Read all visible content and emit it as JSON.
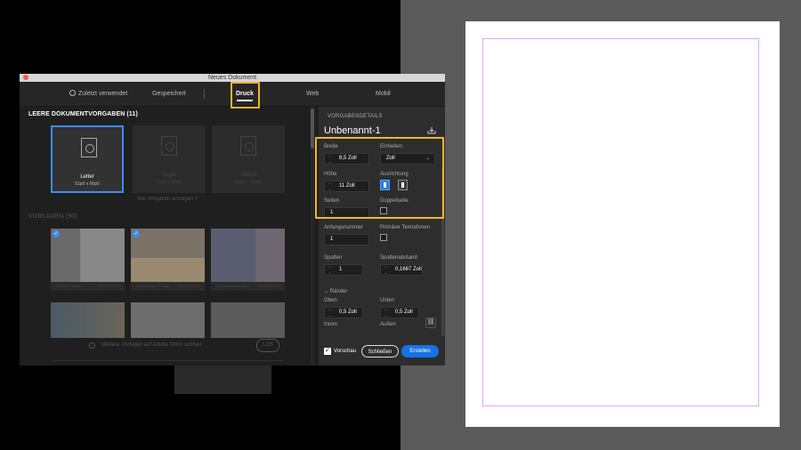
{
  "dialog": {
    "title": "Neues Dokument",
    "tabs": [
      {
        "label": "Zuletzt verwendet"
      },
      {
        "label": "Gespeichert"
      },
      {
        "label": "Druck",
        "active": true
      },
      {
        "label": "Web"
      },
      {
        "label": "Mobil"
      }
    ]
  },
  "presets": {
    "heading": "LEERE DOKUMENTVORGABEN (11)",
    "items": [
      {
        "name": "Letter",
        "size": "51p0 x 66p0"
      },
      {
        "name": "Legal",
        "size": "51p0 x 84p0"
      },
      {
        "name": "Tabloid",
        "size": "66p0 x 102p0"
      }
    ],
    "show_all": "Alle Vorgaben anzeigen +"
  },
  "templates": {
    "heading": "VORLAGEN (50)",
    "items": [
      {
        "name": "Echtzeit-Layout",
        "tag": "KOSTENLOS",
        "checked": true
      },
      {
        "name": "Arbeitsbogen Vorlage",
        "tag": "KOSTENLOS",
        "checked": true
      },
      {
        "name": "Verkaufsbroschüren",
        "tag": "KOSTENLOS",
        "checked": false
      }
    ],
    "search_placeholder": "Weitere Vorlagen auf Adobe Stock suchen",
    "search_button": "LOS"
  },
  "details": {
    "header": "VORGABENDETAILS",
    "doc_name": "Unbenannt-1",
    "width_label": "Breite",
    "width_value": "8,5 Zoll",
    "units_label": "Einheiten",
    "units_value": "Zoll",
    "height_label": "Höhe",
    "height_value": "11 Zoll",
    "orientation_label": "Ausrichtung",
    "pages_label": "Seiten",
    "pages_value": "1",
    "facing_label": "Doppelseite",
    "start_label": "Anfangsnummer",
    "start_value": "1",
    "primary_frame_label": "Primärer Textrahmen",
    "columns_label": "Spalten",
    "columns_value": "1",
    "gutter_label": "Spaltenabstand",
    "gutter_value": "0,1667 Zoll",
    "margins_label": "Ränder",
    "top_label": "Oben",
    "top_value": "0,5 Zoll",
    "bottom_label": "Unten",
    "bottom_value": "0,5 Zoll",
    "inside_label": "Innen",
    "outside_label": "Außen",
    "preview_label": "Vorschau",
    "close_button": "Schließen",
    "create_button": "Erstellen"
  },
  "colors": {
    "highlight": "#f7b42c",
    "accent": "#1473e6",
    "margin_guide": "#e3a8f0"
  }
}
